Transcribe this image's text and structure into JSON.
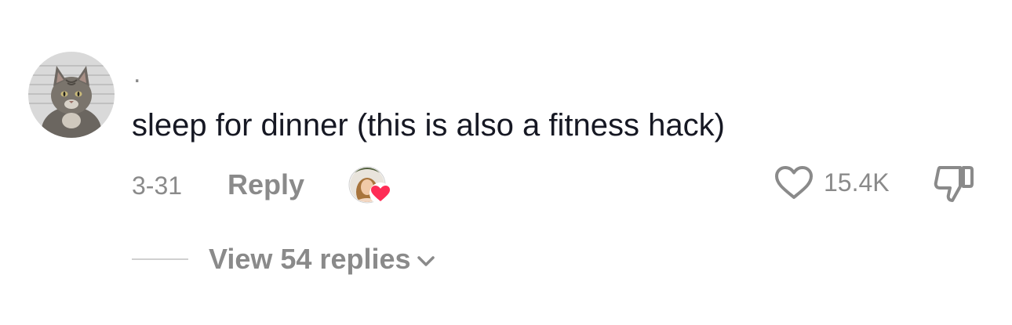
{
  "comment": {
    "username": ".",
    "text": "sleep for dinner (this is also a fitness hack)",
    "date": "3-31",
    "reply_label": "Reply",
    "like_count": "15.4K",
    "creator_liked": true,
    "replies_label": "View 54 replies",
    "icons": {
      "avatar": "cat-avatar",
      "creator_badge": "creator-liked-avatar",
      "like": "heart-outline-icon",
      "dislike": "thumbs-down-icon",
      "expand": "chevron-down-icon"
    },
    "colors": {
      "text_primary": "#161823",
      "text_secondary": "#8a8a8a",
      "heart_accent": "#fe2c55"
    }
  }
}
